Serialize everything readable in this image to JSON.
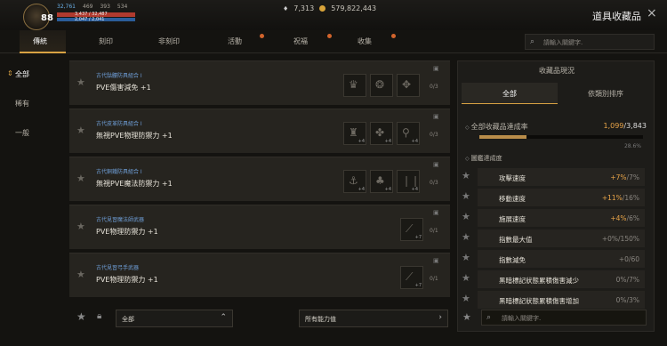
{
  "player": {
    "level": "88",
    "stat1": "32,761",
    "stat2": "469",
    "stat3": "393",
    "stat4": "534",
    "hp_text": "3,437 / 32,487",
    "mp_text": "2,047 / 2,041"
  },
  "currency": {
    "diamond": "7,313",
    "gold": "579,822,443"
  },
  "window": {
    "title": "道具收藏品",
    "close": "×"
  },
  "tabs": [
    "傳統",
    "刻印",
    "非刻印",
    "活動",
    "祝福",
    "收集"
  ],
  "search_top": {
    "placeholder": "請輸入關鍵字."
  },
  "sidebar": {
    "items": [
      {
        "label": "全部",
        "mark": "⇕"
      },
      {
        "label": "稀有"
      },
      {
        "label": "一般"
      }
    ]
  },
  "cards": [
    {
      "set": "古代骷髏防具組合 I",
      "name": "PVE傷害減免 +1",
      "count": "0/3",
      "slots": [
        {
          "icon": "helmet-icon",
          "glyph": "♛",
          "num": ""
        },
        {
          "icon": "armor-icon",
          "glyph": "❂",
          "num": ""
        },
        {
          "icon": "gloves-icon",
          "glyph": "✥",
          "num": ""
        }
      ]
    },
    {
      "set": "古代皮革防具組合 I",
      "name": "無視PVE物理防禦力 +1",
      "count": "0/3",
      "slots": [
        {
          "icon": "helmet-icon",
          "glyph": "♜",
          "num": "+4"
        },
        {
          "icon": "armor-icon",
          "glyph": "✤",
          "num": "+4"
        },
        {
          "icon": "boots-icon",
          "glyph": "⚲",
          "num": "+4"
        }
      ]
    },
    {
      "set": "古代銅鐵防具組合 I",
      "name": "無視PVE魔法防禦力 +1",
      "count": "0/3",
      "slots": [
        {
          "icon": "shoes-icon",
          "glyph": "⚓",
          "num": "+4"
        },
        {
          "icon": "armor-icon",
          "glyph": "♣",
          "num": "+4"
        },
        {
          "icon": "boots-icon",
          "glyph": "❘❘",
          "num": "+4"
        }
      ]
    },
    {
      "set": "古代見習魔法師武器",
      "name": "PVE物理防禦力 +1",
      "count": "0/1",
      "slots": [
        {
          "icon": "staff-icon",
          "glyph": "⟋",
          "num": "+7"
        }
      ]
    },
    {
      "set": "古代見習弓手武器",
      "name": "PVE物理防禦力 +1",
      "count": "0/1",
      "slots": [
        {
          "icon": "bow-icon",
          "glyph": "⟋",
          "num": "+7"
        }
      ]
    }
  ],
  "bottom": {
    "filter_label": "全部",
    "stat_filter_label": "所有能力值"
  },
  "collection": {
    "title": "收藏品現況",
    "tab_all": "全部",
    "tab_sort": "依類別排序",
    "rate_label": "全部收藏品達成率",
    "rate_current": "1,099",
    "rate_total": "/3,843",
    "rate_pct": "28.6%",
    "rate_fraction": 0.286,
    "section_label": "圖鑑達成度",
    "stats": [
      {
        "name": "攻擊速度",
        "cur": "+7%",
        "max": "/7%",
        "highlight": true
      },
      {
        "name": "移動速度",
        "cur": "+11%",
        "max": "/16%",
        "highlight": true
      },
      {
        "name": "施展速度",
        "cur": "+4%",
        "max": "/6%",
        "highlight": true
      },
      {
        "name": "指數最大值",
        "cur": "+0%",
        "max": "/150%",
        "highlight": false
      },
      {
        "name": "指數減免",
        "cur": "+0",
        "max": "/60",
        "highlight": false
      },
      {
        "name": "黑暗標記狀態累積傷害減少",
        "cur": "0%",
        "max": "/7%",
        "highlight": false
      },
      {
        "name": "黑暗標記狀態累積傷害增加",
        "cur": "0%",
        "max": "/3%",
        "highlight": false
      }
    ],
    "search_placeholder": "請輸入關鍵字."
  },
  "colors": {
    "accent": "#d8a243",
    "set_name": "#6f9fd8",
    "value_highlight": "#e8a448"
  }
}
